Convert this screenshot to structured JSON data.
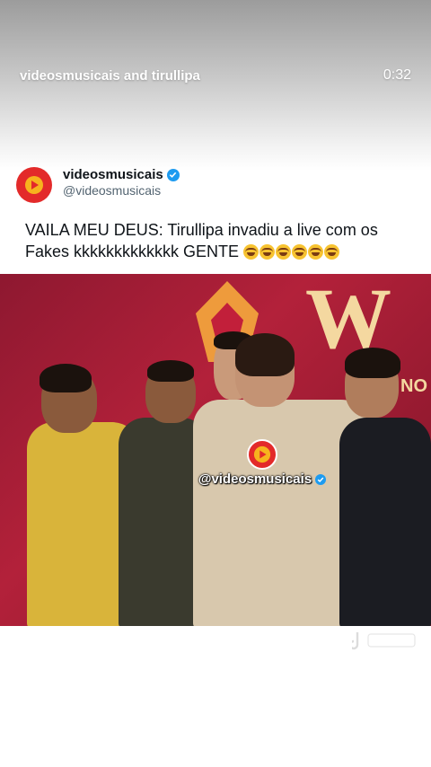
{
  "story": {
    "title": "videosmusicais and tirullipa",
    "time": "0:32"
  },
  "tweet": {
    "display_name": "videosmusicais",
    "handle": "@videosmusicais",
    "text": "VAILA MEU DEUS: Tirullipa invadiu a live com os Fakes kkkkkkkkkkkkk GENTE",
    "emoji_count": 6,
    "verified_color": "#1d9bf0",
    "avatar_color": "#e32a2a"
  },
  "video": {
    "watermark": "@videosmusicais",
    "show_logo": "W",
    "show_logo_sub": "NO"
  },
  "colors": {
    "accent": "#1d9bf0",
    "brand": "#e32a2a",
    "stage_bg": "#b3213a"
  }
}
